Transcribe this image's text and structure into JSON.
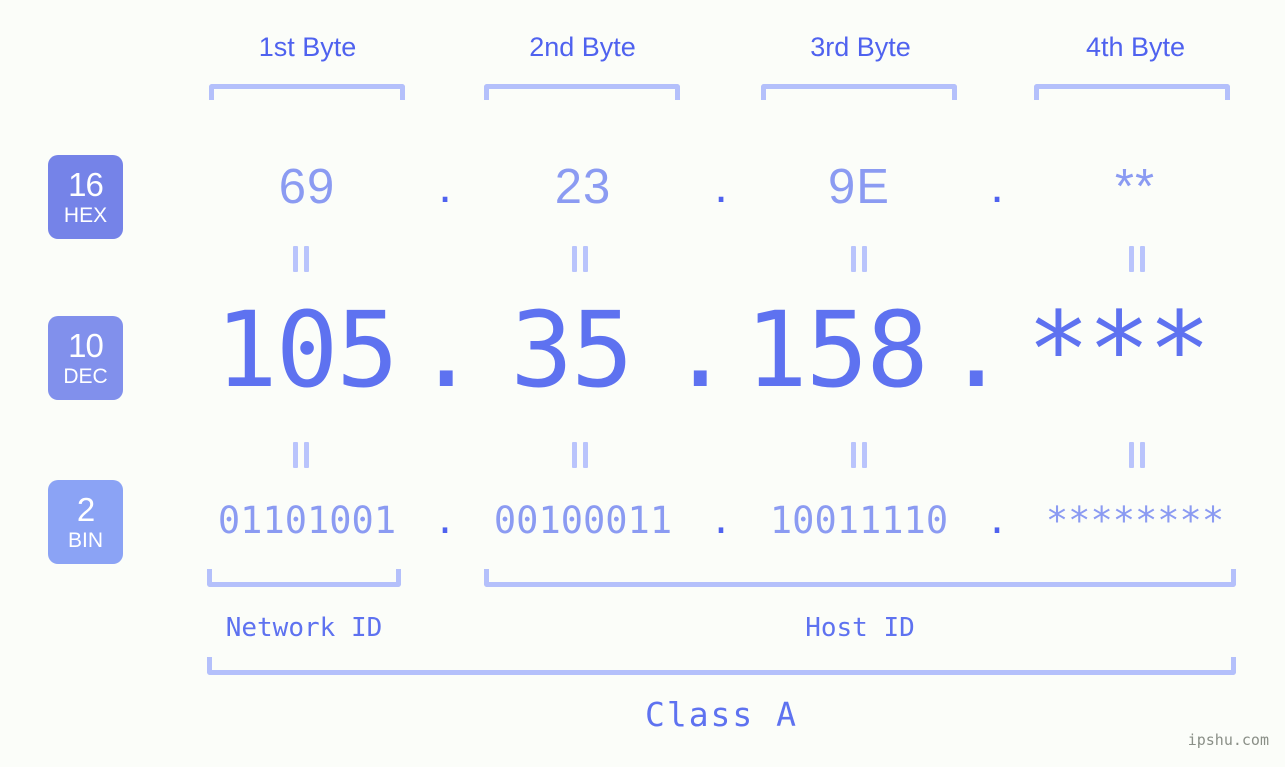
{
  "background_color": "#fbfdf9",
  "accent_color": "#5e72f0",
  "accent_light_color": "#8b9bf2",
  "bracket_color": "#b4c0fb",
  "byte_headers": [
    {
      "label": "1st Byte"
    },
    {
      "label": "2nd Byte"
    },
    {
      "label": "3rd Byte"
    },
    {
      "label": "4th Byte"
    }
  ],
  "rows": [
    {
      "radix": "16",
      "name": "HEX",
      "badge_color": "#7583e8",
      "values": [
        "69",
        "23",
        "9E",
        "**"
      ],
      "separator": "."
    },
    {
      "radix": "10",
      "name": "DEC",
      "badge_color": "#8190ec",
      "values": [
        "105",
        "35",
        "158",
        "***"
      ],
      "separator": "."
    },
    {
      "radix": "2",
      "name": "BIN",
      "badge_color": "#8ba3f5",
      "values": [
        "01101001",
        "00100011",
        "10011110",
        "********"
      ],
      "separator": "."
    }
  ],
  "equality_symbol": "=",
  "id_sections": [
    {
      "label": "Network ID"
    },
    {
      "label": "Host ID"
    }
  ],
  "class_label": "Class A",
  "watermark": "ipshu.com"
}
